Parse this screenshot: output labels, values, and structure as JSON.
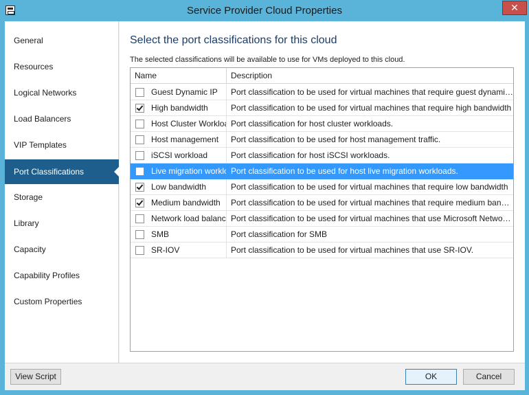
{
  "window": {
    "title": "Service Provider Cloud Properties",
    "close_label": "✕"
  },
  "sidebar": {
    "items": [
      {
        "label": "General"
      },
      {
        "label": "Resources"
      },
      {
        "label": "Logical Networks"
      },
      {
        "label": "Load Balancers"
      },
      {
        "label": "VIP Templates"
      },
      {
        "label": "Port Classifications",
        "selected": true
      },
      {
        "label": "Storage"
      },
      {
        "label": "Library"
      },
      {
        "label": "Capacity"
      },
      {
        "label": "Capability Profiles"
      },
      {
        "label": "Custom Properties"
      }
    ]
  },
  "main": {
    "title": "Select the port classifications for this cloud",
    "description": "The selected classifications will be available to use for VMs deployed to this cloud.",
    "columns": {
      "name": "Name",
      "description": "Description"
    },
    "rows": [
      {
        "name": "Guest Dynamic IP",
        "description": "Port classification to be used for virtual machines that require guest dynamic IP",
        "checked": false
      },
      {
        "name": "High bandwidth",
        "description": "Port classification to be used for virtual machines that require high bandwidth",
        "checked": true
      },
      {
        "name": "Host Cluster Workload",
        "description": "Port classification for host cluster workloads.",
        "checked": false
      },
      {
        "name": "Host management",
        "description": "Port classification to be used for host management traffic.",
        "checked": false
      },
      {
        "name": "iSCSI workload",
        "description": "Port classification for host iSCSI workloads.",
        "checked": false
      },
      {
        "name": "Live migration  workload",
        "description": "Port classification to be used for host live migration workloads.",
        "checked": false,
        "selected": true
      },
      {
        "name": "Low bandwidth",
        "description": "Port classification to be used for virtual machines that require low bandwidth",
        "checked": true
      },
      {
        "name": "Medium bandwidth",
        "description": "Port classification to be used for virtual machines that require medium bandwidth",
        "checked": true
      },
      {
        "name": "Network load balancer",
        "description": "Port classification to be used for virtual machines that use Microsoft Network Load Balancing",
        "checked": false
      },
      {
        "name": "SMB",
        "description": "Port classification for SMB",
        "checked": false
      },
      {
        "name": "SR-IOV",
        "description": "Port classification to be used for virtual machines that use SR-IOV.",
        "checked": false
      }
    ]
  },
  "footer": {
    "view_script_label": "View Script",
    "ok_label": "OK",
    "cancel_label": "Cancel"
  },
  "colors": {
    "title_bar": "#5ab3d8",
    "nav_selected": "#1e5e8d",
    "row_selected": "#3399ff",
    "close_button": "#c7504b"
  }
}
